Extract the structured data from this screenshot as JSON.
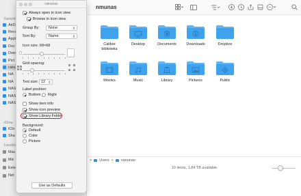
{
  "finder": {
    "title": "nmunas",
    "sidebar": {
      "favorites_head": "Favorit",
      "icloud_head": "iClou",
      "locations_head": "Locatio",
      "items": [
        {
          "label": "AirD",
          "icon": "airdrop-icon"
        },
        {
          "label": "Rece",
          "icon": "clock-icon"
        },
        {
          "label": "Appl",
          "icon": "applications-icon"
        },
        {
          "label": "Doc",
          "icon": "doc-icon"
        },
        {
          "label": "Dow",
          "icon": "download-icon"
        },
        {
          "label": "Pict",
          "icon": "pictures-icon"
        },
        {
          "label": "rainu",
          "icon": "home-icon",
          "selected": true
        },
        {
          "label": "NA",
          "icon": "folder-icon"
        },
        {
          "label": "NA",
          "icon": "folder-icon"
        },
        {
          "label": "NAS",
          "icon": "folder-icon"
        },
        {
          "label": "NAS",
          "icon": "folder-icon"
        },
        {
          "label": "NAS",
          "icon": "folder-icon"
        }
      ],
      "icloud_items": [
        {
          "label": "iClo",
          "icon": "cloud-icon"
        },
        {
          "label": "Sha",
          "icon": "shared-icon"
        }
      ],
      "location_items": [
        {
          "label": "Mac",
          "icon": "laptop-icon"
        },
        {
          "label": "Mic",
          "icon": "disk-icon"
        },
        {
          "label": "Exte",
          "icon": "disk-icon"
        },
        {
          "label": "Net",
          "icon": "globe-icon"
        }
      ]
    },
    "folders": [
      {
        "label": "Calibre\nbiblioteka",
        "glyph": "none"
      },
      {
        "label": "Desktop",
        "glyph": "desktop"
      },
      {
        "label": "Documents",
        "glyph": "doc"
      },
      {
        "label": "Downloads",
        "glyph": "download"
      },
      {
        "label": "Dropbox",
        "glyph": "none"
      },
      {
        "label": "Movies",
        "glyph": "film"
      },
      {
        "label": "Music",
        "glyph": "note"
      },
      {
        "label": "Library",
        "glyph": "library"
      },
      {
        "label": "Pictures",
        "glyph": "pictures"
      },
      {
        "label": "Public",
        "glyph": "public"
      }
    ],
    "path": {
      "users": "Users",
      "sep": ">",
      "home": "rainunas"
    },
    "status": "10 items, 1,84 TB available",
    "icon_size_level": 0.3
  },
  "panel": {
    "title": "rainunas",
    "always_open": "Always open in icon view",
    "browse": "Browse in icon view",
    "group_by_label": "Group By:",
    "group_by_value": "None",
    "sort_by_label": "Sort By:",
    "sort_by_value": "Name",
    "icon_size_label": "Icon size:",
    "icon_size_value": "68×68",
    "icon_size_level": 0.45,
    "grid_spacing_label": "Grid spacing:",
    "grid_spacing_level": 0.2,
    "text_size_label": "Text size:",
    "text_size_value": "12",
    "label_position_label": "Label position:",
    "label_bottom": "Bottom",
    "label_right": "Right",
    "show_item_info": "Show item info",
    "show_icon_preview": "Show icon preview",
    "show_library_folder": "Show Library Folder",
    "background_label": "Background:",
    "bg_default": "Default",
    "bg_color": "Color",
    "bg_picture": "Picture",
    "use_as_defaults": "Use as Defaults",
    "highlight_color": "#c4202b"
  },
  "colors": {
    "folder_top": "#5fb6f3",
    "folder_body": "#3ea2ec",
    "folder_glyph": "#2a7cc4",
    "accent": "#2f8ce8"
  }
}
